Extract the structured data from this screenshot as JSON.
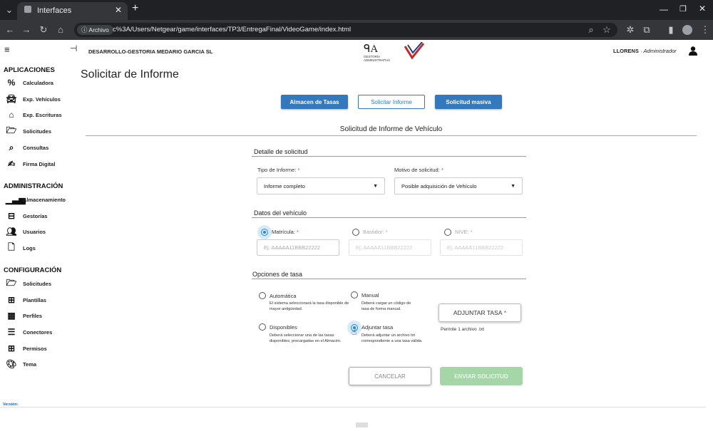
{
  "browser": {
    "tab_title": "Interfaces",
    "new_tab": "+",
    "url_chip": "Archivo",
    "url": "c%3A/Users/Netgear/game/interfaces/TP3/EntregaFinal/VideoGame/index.html"
  },
  "header": {
    "company": "DESARROLLO-GESTORIA MEDARIO GARCIA SL",
    "logo_text": "GESTORÍA ADMINISTRATIVA",
    "user": "LLORENS",
    "role": "Administrador",
    "separator": "·"
  },
  "sidebar": {
    "sections": [
      {
        "title": "APLICACIONES",
        "items": [
          "Calculadora",
          "Exp. Vehículos",
          "Exp. Escrituras",
          "Solicitudes",
          "Consultas",
          "Firma Digital"
        ]
      },
      {
        "title": "ADMINISTRACIÓN",
        "items": [
          "Almacenamiento",
          "Gestorías",
          "Usuarios",
          "Logs"
        ]
      },
      {
        "title": "CONFIGURACIÓN",
        "items": [
          "Solicitudes",
          "Plantillas",
          "Perfiles",
          "Conectores",
          "Permisos",
          "Tema"
        ]
      }
    ],
    "version": "Versión:"
  },
  "main": {
    "page_title": "Solicitar de Informe",
    "tabs": [
      "Almacen de Tasas",
      "Solicitar Informe",
      "Solicitud masiva"
    ],
    "form_title": "Solicitud de Informe de Vehículo",
    "detalle": {
      "title": "Detalle de solicitud",
      "tipo_label": "Tipo de Informe:",
      "tipo_value": "Informe completo",
      "motivo_label": "Motivo de solicitud:",
      "motivo_value": "Posible adquisición de Vehículo",
      "required": "*"
    },
    "vehiculo": {
      "title": "Datos del vehículo",
      "matricula": "Matrícula:",
      "bastidor": "Bastidor:",
      "nive": "NIVE:",
      "placeholder": "Ej: AAAAA11BBB22222"
    },
    "tasa": {
      "title": "Opciones de tasa",
      "automatica": "Automática",
      "automatica_desc": "El sistema seleccionará la tasa disponible de mayor antigüedad.",
      "manual": "Manual",
      "manual_desc": "Deberá cargar un código de tasa de forma manual.",
      "disponibles": "Disponibles",
      "disponibles_desc": "Deberá seleccionar una de las tasas disponibles, precargadas en el Almacén.",
      "adjuntar": "Adjuntar tasa",
      "adjuntar_desc": "Deberá adjuntar un archivo txt correspondiente a una tasa válida.",
      "adjuntar_button": "ADJUNTAR TASA",
      "permite": "Permite 1 archivo .txt"
    },
    "cancel": "CANCELAR",
    "submit": "ENVIAR SOLICITUD"
  },
  "colors": {
    "accent": "#3478be",
    "success": "#a5d6a7",
    "radio": "#1e88e5"
  }
}
